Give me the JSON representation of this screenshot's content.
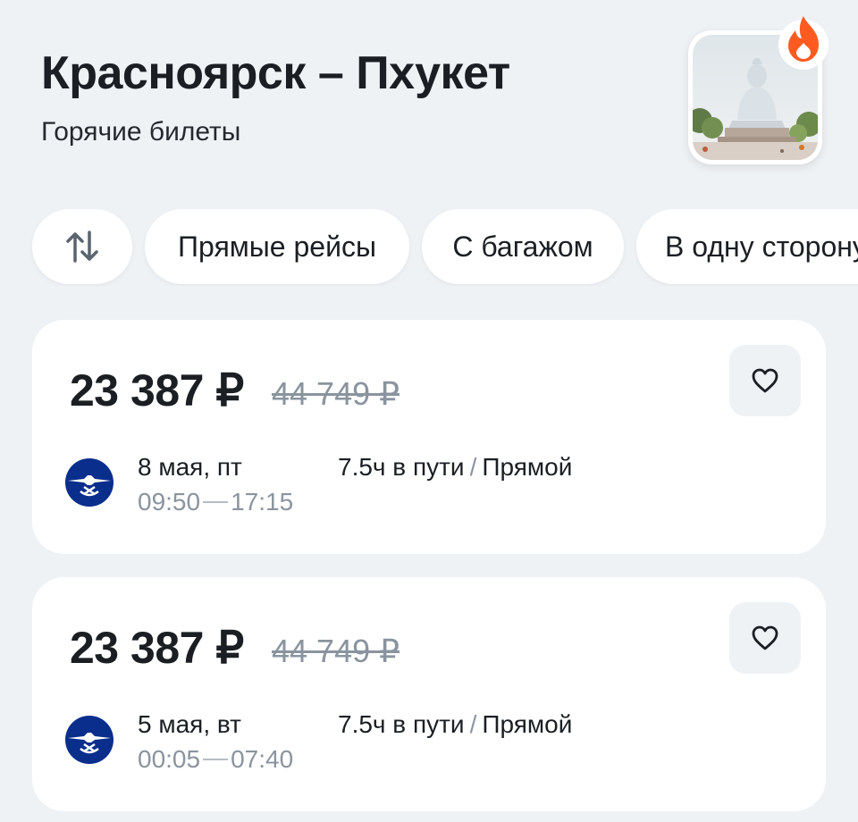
{
  "header": {
    "title": "Красноярск – Пхукет",
    "subtitle": "Горячие билеты",
    "photo_icon": "buddha-statue-photo",
    "badge_icon": "fire-icon"
  },
  "filters": {
    "sort_icon": "sort-arrows-icon",
    "chips": [
      {
        "label": "Прямые рейсы"
      },
      {
        "label": "С багажом"
      },
      {
        "label": "В одну сторону"
      }
    ]
  },
  "tickets": [
    {
      "price": "23 387 ₽",
      "old_price": "44 749 ₽",
      "date": "8 мая, пт",
      "departure": "09:50",
      "arrival": "17:15",
      "duration": "7.5ч в пути",
      "separator": "/",
      "type": "Прямой",
      "airline_icon": "aeroflot-logo-icon",
      "favorite_icon": "heart-icon"
    },
    {
      "price": "23 387 ₽",
      "old_price": "44 749 ₽",
      "date": "5 мая, вт",
      "departure": "00:05",
      "arrival": "07:40",
      "duration": "7.5ч в пути",
      "separator": "/",
      "type": "Прямой",
      "airline_icon": "aeroflot-logo-icon",
      "favorite_icon": "heart-icon"
    }
  ],
  "colors": {
    "background": "#eff2f5",
    "card": "#ffffff",
    "text_primary": "#1b1f23",
    "text_muted": "#8a949e",
    "airline_blue": "#0a2e8c",
    "fire_orange": "#ff5b21"
  }
}
